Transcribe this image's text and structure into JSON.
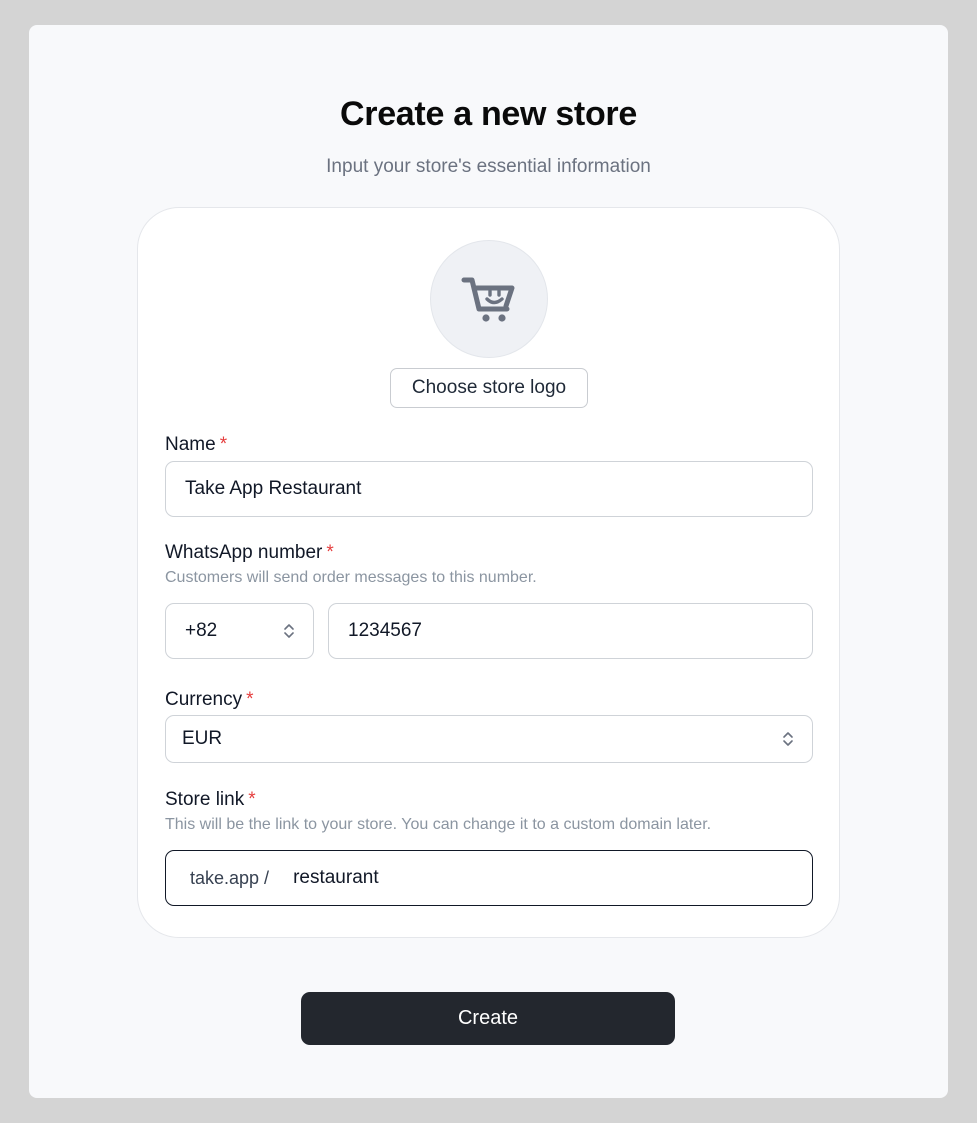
{
  "page": {
    "title": "Create a new store",
    "subtitle": "Input your store's essential information"
  },
  "logo": {
    "icon": "cart-smile-icon",
    "button_label": "Choose store logo"
  },
  "name": {
    "label": "Name",
    "required_mark": "*",
    "value": "Take App Restaurant"
  },
  "whatsapp": {
    "label": "WhatsApp number",
    "required_mark": "*",
    "hint": "Customers will send order messages to this number.",
    "country_code": "+82",
    "number": "1234567"
  },
  "currency": {
    "label": "Currency",
    "required_mark": "*",
    "value": "EUR"
  },
  "store_link": {
    "label": "Store link",
    "required_mark": "*",
    "hint": "This will be the link to your store. You can change it to a custom domain later.",
    "prefix": "take.app /",
    "value": "restaurant"
  },
  "submit": {
    "label": "Create"
  },
  "colors": {
    "background": "#d4d4d4",
    "panel": "#f8f9fb",
    "card": "#ffffff",
    "required": "#e53e3e",
    "primary_button": "#23272e"
  }
}
